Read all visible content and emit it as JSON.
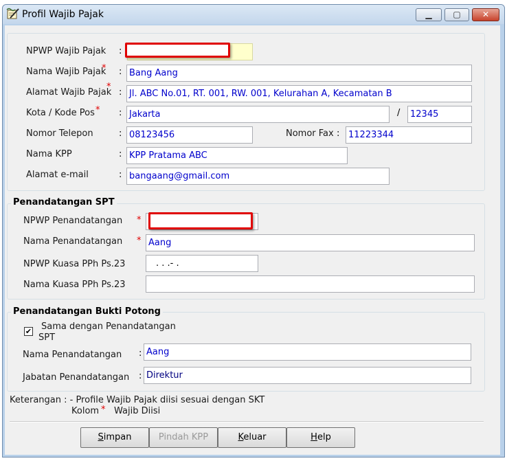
{
  "window": {
    "title": "Profil Wajib Pajak",
    "minimize_glyph": "▁",
    "maximize_glyph": "▢",
    "close_glyph": "✕",
    "app_icon": "notepad-pen-icon"
  },
  "profile": {
    "npwp_label": "NPWP Wajib Pajak",
    "npwp_value": "",
    "nama_label": "Nama Wajib Pajak",
    "nama_value": "Bang Aang",
    "alamat_label": "Alamat Wajib Pajak",
    "alamat_value": "Jl. ABC No.01, RT. 001, RW. 001, Kelurahan A, Kecamatan B",
    "kota_label": "Kota / Kode Pos",
    "kota_value": "Jakarta",
    "slash": "/",
    "kodepos_value": "12345",
    "telepon_label": "Nomor Telepon",
    "telepon_value": "08123456",
    "fax_label": "Nomor Fax",
    "fax_value": "11223344",
    "kpp_label": "Nama KPP",
    "kpp_value": "KPP Pratama ABC",
    "email_label": "Alamat e-mail",
    "email_value": "bangaang@gmail.com"
  },
  "spt": {
    "title": "Penandatangan SPT",
    "npwp_label": "NPWP Penandatangan",
    "npwp_value": "",
    "nama_label": "Nama Penandatangan",
    "nama_value": "Aang",
    "kuasa_npwp_label": "NPWP Kuasa PPh Ps.23",
    "kuasa_npwp_value": ". . .-  .",
    "kuasa_nama_label": "Nama Kuasa PPh Ps.23",
    "kuasa_nama_value": ""
  },
  "bukti": {
    "title": "Penandatangan Bukti Potong",
    "same_label_line1": "Sama dengan Penandatangan",
    "same_label_line2": "SPT",
    "same_checked": true,
    "check_glyph": "✔",
    "nama_label": "Nama Penandatangan",
    "nama_value": "Aang",
    "jabatan_label": "Jabatan Penandatangan",
    "jabatan_value": "Direktur"
  },
  "notes": {
    "line1": "Keterangan : - Profile Wajib Pajak diisi sesuai dengan SKT",
    "line2_prefix": "Kolom",
    "line2_star": "*",
    "line2_suffix": "Wajib Diisi"
  },
  "buttons": {
    "simpan_first": "S",
    "simpan_rest": "impan",
    "pindah": "Pindah KPP",
    "keluar_first": "K",
    "keluar_rest": "eluar",
    "help_first": "H",
    "help_rest": "elp"
  },
  "common": {
    "colon": ":",
    "star": "*"
  },
  "colors": {
    "required": "#e00000",
    "value_text": "#0000cc",
    "highlight_border": "#e00000"
  }
}
